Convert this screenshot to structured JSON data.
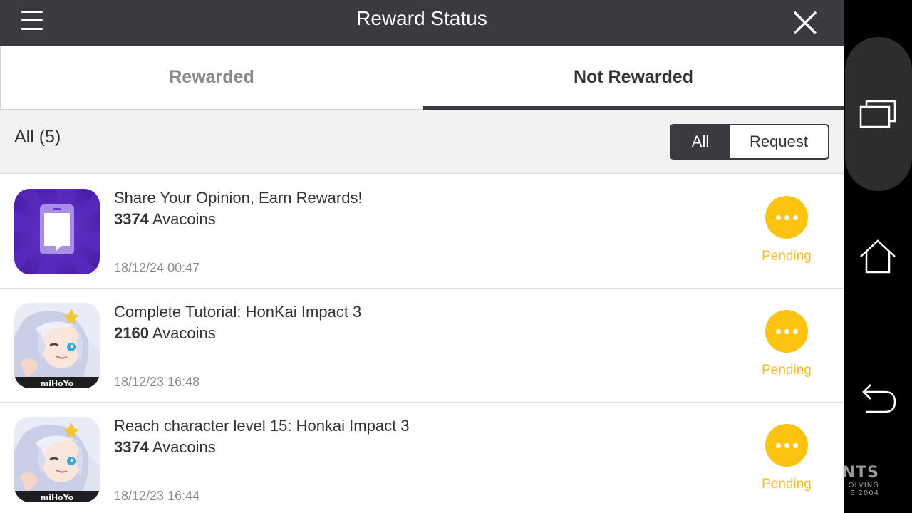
{
  "header": {
    "title": "Reward Status"
  },
  "tabs": [
    {
      "label": "Rewarded",
      "active": false
    },
    {
      "label": "Not Rewarded",
      "active": true
    }
  ],
  "filter": {
    "count_label": "All (5)",
    "options": [
      {
        "label": "All",
        "selected": true
      },
      {
        "label": "Request",
        "selected": false
      }
    ]
  },
  "rows": [
    {
      "title": "Share Your Opinion, Earn Rewards!",
      "amount": "3374",
      "unit": "Avacoins",
      "date": "18/12/24 00:47",
      "status": "Pending",
      "icon": "survey-app-icon"
    },
    {
      "title": "Complete Tutorial: HonKai Impact 3",
      "amount": "2160",
      "unit": "Avacoins",
      "date": "18/12/23 16:48",
      "status": "Pending",
      "icon": "honkai-impact-app-icon",
      "icon_brand": "miHoYo"
    },
    {
      "title": "Reach character level 15: Honkai Impact 3",
      "amount": "3374",
      "unit": "Avacoins",
      "date": "18/12/23 16:44",
      "status": "Pending",
      "icon": "honkai-impact-app-icon",
      "icon_brand": "miHoYo"
    }
  ],
  "watermark": {
    "big": "NTS",
    "line1": "OLVING",
    "line2": "E 2004"
  },
  "colors": {
    "header": "#3a3a40",
    "pending": "#fcc310",
    "muted": "#8a8a8a"
  }
}
